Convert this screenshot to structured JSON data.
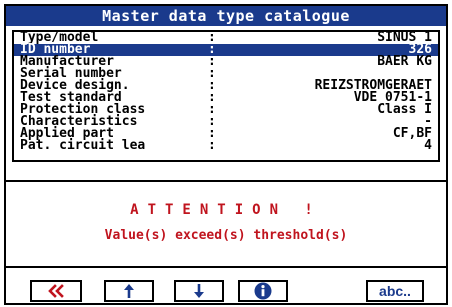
{
  "window": {
    "title": "Master data type catalogue"
  },
  "fields": [
    {
      "label": "Type/model",
      "value": "SINUS 1",
      "selected": false
    },
    {
      "label": "ID number",
      "value": "326",
      "selected": true
    },
    {
      "label": "Manufacturer",
      "value": "BAER KG",
      "selected": false
    },
    {
      "label": "Serial number",
      "value": "",
      "selected": false
    },
    {
      "label": "Device design.",
      "value": "REIZSTROMGERAET",
      "selected": false
    },
    {
      "label": "Test standard",
      "value": "VDE 0751-1",
      "selected": false
    },
    {
      "label": "Protection class",
      "value": "Class I",
      "selected": false
    },
    {
      "label": "Characteristics",
      "value": "-",
      "selected": false
    },
    {
      "label": "Applied part",
      "value": "CF,BF",
      "selected": false
    },
    {
      "label": "Pat. circuit lea",
      "value": "4",
      "selected": false
    }
  ],
  "colon": ":",
  "alert": {
    "heading": "ATTENTION !",
    "message": "Value(s) exceed(s) threshold(s)"
  },
  "toolbar": {
    "keyboard_label": "abc..",
    "icons": [
      "double-left-icon",
      "arrow-up-icon",
      "arrow-down-icon",
      "info-icon"
    ]
  },
  "colors": {
    "accent": "#1a3a8c",
    "alert": "#c0141e"
  }
}
